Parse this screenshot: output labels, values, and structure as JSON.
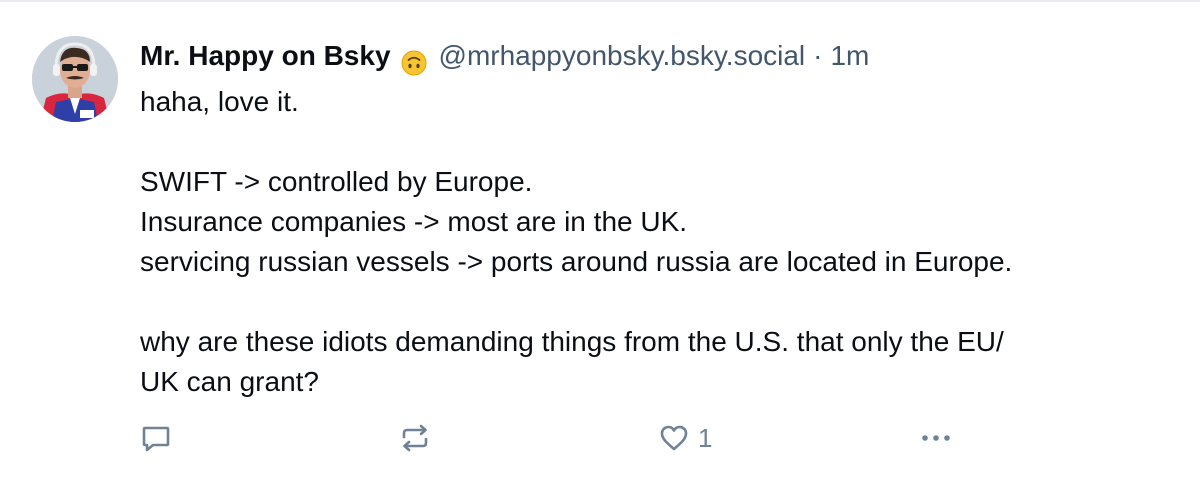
{
  "post": {
    "display_name": "Mr. Happy on Bsky",
    "emoji": "upside-down-face-emoji",
    "handle": "@mrhappyonbsky.bsky.social",
    "separator": "·",
    "time": "1m",
    "text_lines": [
      "haha, love it.",
      "",
      "SWIFT -> controlled by Europe.",
      "Insurance companies -> most are in the UK.",
      "servicing russian vessels -> ports around russia are located in Europe.",
      "",
      "why are these idiots demanding things from the U.S. that only the EU/",
      "UK can grant?"
    ]
  },
  "actions": {
    "reply_icon": "speech-bubble-icon",
    "repost_icon": "repost-arrows-icon",
    "like_icon": "heart-icon",
    "like_count": "1",
    "more_icon": "ellipsis-icon"
  },
  "colors": {
    "text": "#0b0f14",
    "muted": "#42576c",
    "icon": "#6f8296",
    "divider": "#e7eaee"
  }
}
